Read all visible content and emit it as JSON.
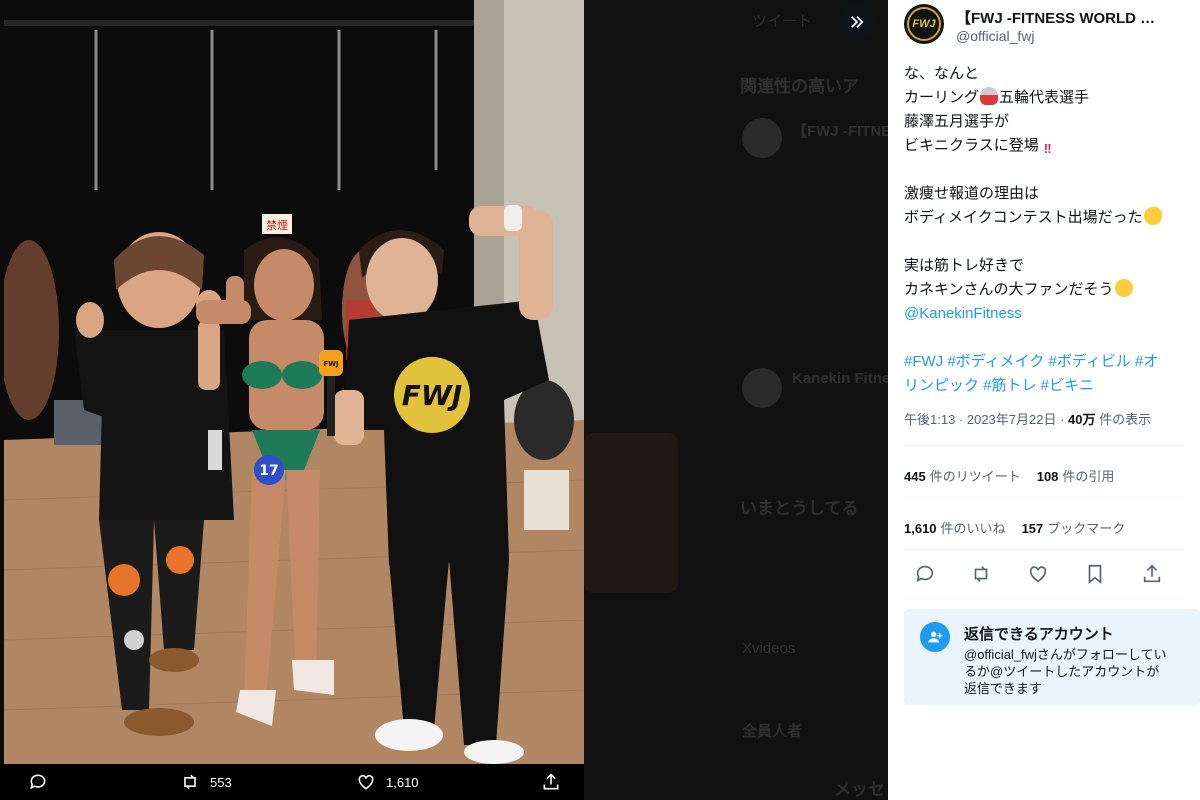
{
  "tweet": {
    "author_name": "【FWJ -FITNESS WORLD J...",
    "author_handle": "@official_fwj",
    "avatar_text": "FWJ",
    "lines": {
      "l1": "な、なんと",
      "l2a": "カーリング",
      "l2b": "五輪代表選手",
      "l3": "藤澤五月選手が",
      "l4": "ビキニクラスに登場",
      "l5": "激痩せ報道の理由は",
      "l6": "ボディメイクコンテスト出場だった",
      "l7": "実は筋トレ好きで",
      "l8": "カネキンさんの大ファンだそう",
      "mention": "@KanekinFitness",
      "hashtags_1": "#FWJ #ボディメイク #ボディビル #オ",
      "hashtags_2": "リンピック #筋トレ #ビキニ"
    },
    "emojis": {
      "curling": "curling-stone",
      "bang": "‼",
      "muscle": "flexed-biceps",
      "think": "thinking-face"
    },
    "meta": {
      "time_date": "午後1:13 · 2023年7月22日 · ",
      "views_num": "40万",
      "views_label": " 件の表示"
    },
    "stats": {
      "retweets_num": "445",
      "retweets_label": "件のリツイート",
      "quotes_num": "108",
      "quotes_label": "件の引用",
      "likes_num": "1,610",
      "likes_label": "件のいいね",
      "bookmarks_num": "157",
      "bookmarks_label": "ブックマーク"
    },
    "reply_notice": {
      "title": "返信できるアカウント",
      "body": "@official_fwjさんがフォローしているか@ツイートしたアカウントが返信できます"
    }
  },
  "media_bar": {
    "retweet_count": "553",
    "like_count": "1,610"
  },
  "photo": {
    "bib_number": "17",
    "sign_text": "禁煙",
    "shirt_text": "FWJ",
    "mic_text": "FWJ"
  },
  "background_page": {
    "header": "ツイート",
    "related": "関連性の高いア",
    "trending": "いまとうしてる",
    "messages": "メッセ",
    "item_a": "【FWJ -FITNE",
    "item_b": "Kanekin Fitnes",
    "item_c": "全員人者",
    "item_d": "Xvideos"
  },
  "colors": {
    "link": "#1d9bf0",
    "text": "#0f1419",
    "muted": "#536471",
    "reply_bg": "#eaf4fc"
  },
  "icons": [
    "expand-icon",
    "reply-icon",
    "retweet-icon",
    "like-icon",
    "bookmark-icon",
    "share-icon",
    "person-add-icon"
  ]
}
